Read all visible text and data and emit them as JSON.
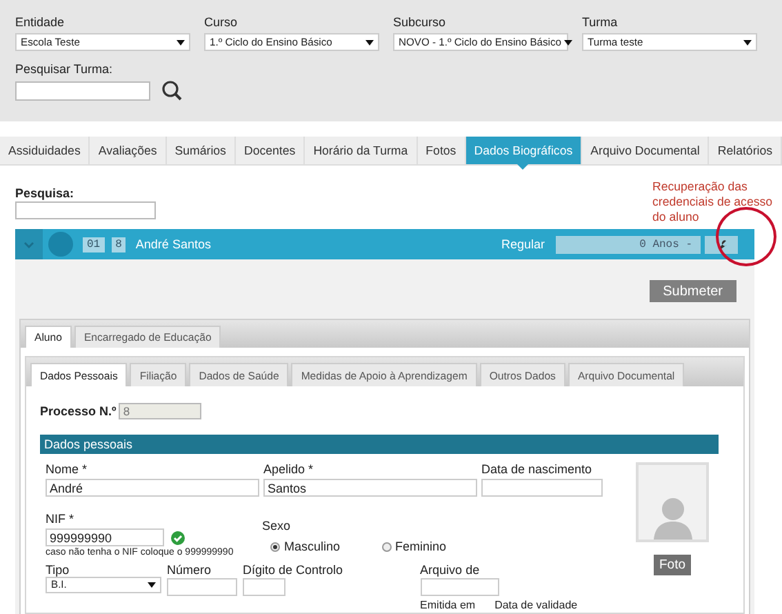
{
  "filters": [
    {
      "label": "Entidade",
      "value": "Escola Teste"
    },
    {
      "label": "Curso",
      "value": "1.º Ciclo do Ensino Básico"
    },
    {
      "label": "Subcurso",
      "value": "NOVO - 1.º Ciclo do Ensino Básico"
    },
    {
      "label": "Turma",
      "value": "Turma teste"
    }
  ],
  "class_search": {
    "label": "Pesquisar Turma:"
  },
  "main_tabs": [
    {
      "label": "Assiduidades",
      "selected": false
    },
    {
      "label": "Avaliações",
      "selected": false
    },
    {
      "label": "Sumários",
      "selected": false
    },
    {
      "label": "Docentes",
      "selected": false
    },
    {
      "label": "Horário da Turma",
      "selected": false
    },
    {
      "label": "Fotos",
      "selected": false
    },
    {
      "label": "Dados Biográficos",
      "selected": true
    },
    {
      "label": "Arquivo Documental",
      "selected": false
    },
    {
      "label": "Relatórios",
      "selected": false
    }
  ],
  "search": {
    "label": "Pesquisa:"
  },
  "annotation": "Recuperação das credenciais de acesso do aluno",
  "student": {
    "number": "01",
    "process": "8",
    "name": "André Santos",
    "status": "Regular",
    "age": "0 Anos -"
  },
  "submit_button": "Submeter",
  "person_tabs": [
    {
      "label": "Aluno",
      "selected": true
    },
    {
      "label": "Encarregado de Educação",
      "selected": false
    }
  ],
  "section_tabs": [
    {
      "label": "Dados Pessoais",
      "selected": true
    },
    {
      "label": "Filiação",
      "selected": false
    },
    {
      "label": "Dados de Saúde",
      "selected": false
    },
    {
      "label": "Medidas de Apoio à Aprendizagem",
      "selected": false
    },
    {
      "label": "Outros Dados",
      "selected": false
    },
    {
      "label": "Arquivo Documental",
      "selected": false
    }
  ],
  "process": {
    "label": "Processo N.º",
    "value": "8"
  },
  "section_title": "Dados pessoais",
  "name_field": {
    "label": "Nome *",
    "value": "André"
  },
  "surname_field": {
    "label": "Apelido *",
    "value": "Santos"
  },
  "birth_date_field": {
    "label": "Data de nascimento"
  },
  "nif_field": {
    "label": "NIF *",
    "value": "999999990",
    "valid": true,
    "hint": "caso não tenha o NIF coloque o 999999990"
  },
  "sex": {
    "label": "Sexo",
    "options": [
      {
        "label": "Masculino",
        "selected": true
      },
      {
        "label": "Feminino",
        "selected": false
      }
    ]
  },
  "document": {
    "type_label": "Tipo",
    "type_value": "B.I.",
    "number_label": "Número",
    "check_digit_label": "Dígito de Controlo",
    "archive_label": "Arquivo de",
    "issued_label": "Emitida em",
    "validity_label": "Data de validade"
  },
  "photo_button": "Foto"
}
